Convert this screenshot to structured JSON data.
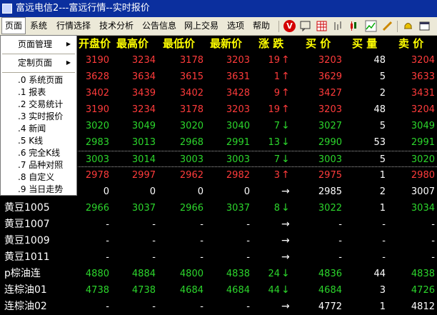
{
  "window": {
    "title": "富远电信2---富远行情--实时报价"
  },
  "menubar": {
    "items": [
      "页面",
      "系统",
      "行情选择",
      "技术分析",
      "公告信息",
      "网上交易",
      "选项",
      "帮助"
    ]
  },
  "toolbar": {
    "icons": [
      "v-logo-icon",
      "speech-bubble-icon",
      "grid-icon",
      "bar-chart-icon",
      "candlestick-icon",
      "line-chart-icon",
      "pen-icon",
      "bell-icon",
      "window-icon"
    ]
  },
  "dropdown": {
    "page_manage": "页面管理",
    "custom_page": "定制页面",
    "items": [
      ".0 系统页面",
      ".1 报表",
      ".2 交易统计",
      ".3 实时报价",
      ".4 新闻",
      ".5 K线",
      ".6 完全K线",
      ".7 品种对照",
      ".8 自定义",
      ".9 当日走势"
    ]
  },
  "table": {
    "headers": [
      "开盘价",
      "最高价",
      "最低价",
      "最新价",
      "涨 跌",
      "买 价",
      "买 量",
      "卖 价"
    ],
    "rows": [
      {
        "name": "",
        "open": "3190",
        "high": "3234",
        "low": "3178",
        "last": "3203",
        "chg": "19",
        "dir": "up",
        "bid": "3203",
        "bidv": "48",
        "ask": "3204"
      },
      {
        "name": "",
        "open": "3628",
        "high": "3634",
        "low": "3615",
        "last": "3631",
        "chg": "1",
        "dir": "up",
        "bid": "3629",
        "bidv": "5",
        "ask": "3633"
      },
      {
        "name": "",
        "open": "3402",
        "high": "3439",
        "low": "3402",
        "last": "3428",
        "chg": "9",
        "dir": "up",
        "bid": "3427",
        "bidv": "2",
        "ask": "3431"
      },
      {
        "name": "",
        "open": "3190",
        "high": "3234",
        "low": "3178",
        "last": "3203",
        "chg": "19",
        "dir": "up",
        "bid": "3203",
        "bidv": "48",
        "ask": "3204"
      },
      {
        "name": "",
        "open": "3020",
        "high": "3049",
        "low": "3020",
        "last": "3040",
        "chg": "7",
        "dir": "down",
        "bid": "3027",
        "bidv": "5",
        "ask": "3049"
      },
      {
        "name": "",
        "open": "2983",
        "high": "3013",
        "low": "2968",
        "last": "2991",
        "chg": "13",
        "dir": "down",
        "bid": "2990",
        "bidv": "53",
        "ask": "2991"
      },
      {
        "name": "",
        "open": "3003",
        "high": "3014",
        "low": "3003",
        "last": "3003",
        "chg": "7",
        "dir": "down",
        "bid": "3003",
        "bidv": "5",
        "ask": "3020"
      },
      {
        "name": "",
        "open": "2978",
        "high": "2997",
        "low": "2962",
        "last": "2982",
        "chg": "3",
        "dir": "up",
        "bid": "2975",
        "bidv": "1",
        "ask": "2980"
      },
      {
        "name": "",
        "open": "0",
        "high": "0",
        "low": "0",
        "last": "0",
        "chg": "",
        "dir": "flat",
        "bid": "2985",
        "bidv": "2",
        "ask": "3007"
      },
      {
        "name": "黄豆1005",
        "open": "2966",
        "high": "3037",
        "low": "2966",
        "last": "3037",
        "chg": "8",
        "dir": "down",
        "bid": "3022",
        "bidv": "1",
        "ask": "3034"
      },
      {
        "name": "黄豆1007",
        "open": "-",
        "high": "-",
        "low": "-",
        "last": "-",
        "chg": "",
        "dir": "flat",
        "bid": "-",
        "bidv": "-",
        "ask": "-"
      },
      {
        "name": "黄豆1009",
        "open": "-",
        "high": "-",
        "low": "-",
        "last": "-",
        "chg": "",
        "dir": "flat",
        "bid": "-",
        "bidv": "-",
        "ask": "-"
      },
      {
        "name": "黄豆1011",
        "open": "-",
        "high": "-",
        "low": "-",
        "last": "-",
        "chg": "",
        "dir": "flat",
        "bid": "-",
        "bidv": "-",
        "ask": "-"
      },
      {
        "name": "p棕油连",
        "open": "4880",
        "high": "4884",
        "low": "4800",
        "last": "4838",
        "chg": "24",
        "dir": "down",
        "bid": "4836",
        "bidv": "44",
        "ask": "4838"
      },
      {
        "name": "连棕油01",
        "open": "4738",
        "high": "4738",
        "low": "4684",
        "last": "4684",
        "chg": "44",
        "dir": "down",
        "bid": "4684",
        "bidv": "3",
        "ask": "4726"
      },
      {
        "name": "连棕油02",
        "open": "-",
        "high": "-",
        "low": "-",
        "last": "-",
        "chg": "",
        "dir": "flat",
        "bid": "4772",
        "bidv": "1",
        "ask": "4812"
      }
    ]
  },
  "colors": {
    "up": "#ff3b3b",
    "down": "#2cd62c",
    "header": "#ffff00",
    "titlebar": "#0b2f9e"
  }
}
